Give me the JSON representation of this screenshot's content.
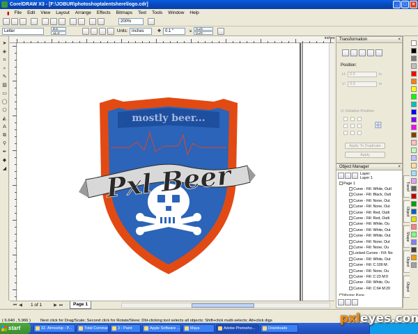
{
  "window": {
    "title": "CorelDRAW X3 - [F:\\JOBUR\\photoshoptalentshere\\logo.cdr]",
    "controls": [
      "_",
      "□",
      "×"
    ]
  },
  "menu": [
    "File",
    "Edit",
    "View",
    "Layout",
    "Arrange",
    "Effects",
    "Bitmaps",
    "Text",
    "Tools",
    "Window",
    "Help"
  ],
  "toolbar": {
    "zoom": "200%",
    "paper": "Letter",
    "width": "8.5 \"",
    "height": "11.0 \"",
    "units_label": "Units:",
    "units_value": "Inches",
    "nudge": "0.1 \"",
    "dup_x": "0.25 \"",
    "dup_y": "0.25 \""
  },
  "logo": {
    "tagline": "mostly beer...",
    "name": "Pxl Beer",
    "colors": {
      "shield_outer": "#e24a14",
      "shield_inner": "#2b64b8",
      "banner": "#d8d8d8",
      "text_dark": "#2a2a2a",
      "tagline_color": "#a7b8e2",
      "skull": "#ffffff",
      "pulse_line": "#e0452a"
    }
  },
  "transformation": {
    "title": "Transformation",
    "position_label": "Position:",
    "h_label": "H:",
    "v_label": "V:",
    "h_value": "0.0",
    "v_value": "0.0",
    "unit": "in",
    "relative_label": "Relative Position",
    "apply_dup": "Apply To Duplicate",
    "apply": "Apply"
  },
  "object_manager": {
    "title": "Object Manager",
    "page_label": "Page 1",
    "layer_label": "Layer 1",
    "layer_prefix": "Layer:",
    "items": [
      "Curve - Fill: White, Outl",
      "Curve - Fill: Black, Outl",
      "Curve - Fill: None, Out",
      "Curve - Fill: None, Out",
      "Curve - Fill: Red, Outli",
      "Curve - Fill: Red, Outli",
      "Curve - Fill: White, Ou",
      "Curve - Fill: White, Out",
      "Curve - Fill: White, Out",
      "Curve - Fill: None, Out",
      "Curve - Fill: None, Ou",
      "Locked Curves - Fill: No",
      "Curve - Fill: White, Out",
      "Curve - Fill: C:100 M:",
      "Curve - Fill: None, Ou",
      "Curve - Fill: C:23 M:0",
      "Curve - Fill: White, Ou",
      "Curve - Fill: C:64 M:20"
    ],
    "master_page": "Master Page"
  },
  "side_tabs": [
    "Transf",
    "Object",
    "Shape",
    "Object",
    "Object"
  ],
  "palette": [
    "#ffffff",
    "#000000",
    "#808080",
    "#c0c0c0",
    "#ff0000",
    "#ff8000",
    "#ffff00",
    "#00ff00",
    "#00c0c0",
    "#0000ff",
    "#8000ff",
    "#ff00ff",
    "#804000",
    "#ffc0c0",
    "#c0ffc0",
    "#c0c0ff",
    "#ffe0a0",
    "#a0e0ff",
    "#e0a0ff",
    "#606060",
    "#c00000",
    "#00a000",
    "#0060c0",
    "#e0e000",
    "#ff8080",
    "#80ff80",
    "#8080ff",
    "#404040",
    "#f0a000",
    "#a0a0a0"
  ],
  "page_nav": {
    "counter": "1 of 1",
    "tab": "Page 1"
  },
  "status": {
    "coords": "( 6.640 , 5.966 )",
    "hint": "Next click for Drag/Scale; Second click for Rotate/Skew; Dbl-clicking tool selects all objects; Shift+click multi-selects; Alt+click digs"
  },
  "taskbar": {
    "start": "start",
    "tasks": [
      "32. Atmoship - P...",
      "Total Command...",
      "3 - Paint",
      "Apple Software ...",
      "Maya",
      "Adobe Photosho...",
      "Downloads"
    ],
    "watermark_a": "pxl",
    "watermark_b": "eyes.com"
  }
}
